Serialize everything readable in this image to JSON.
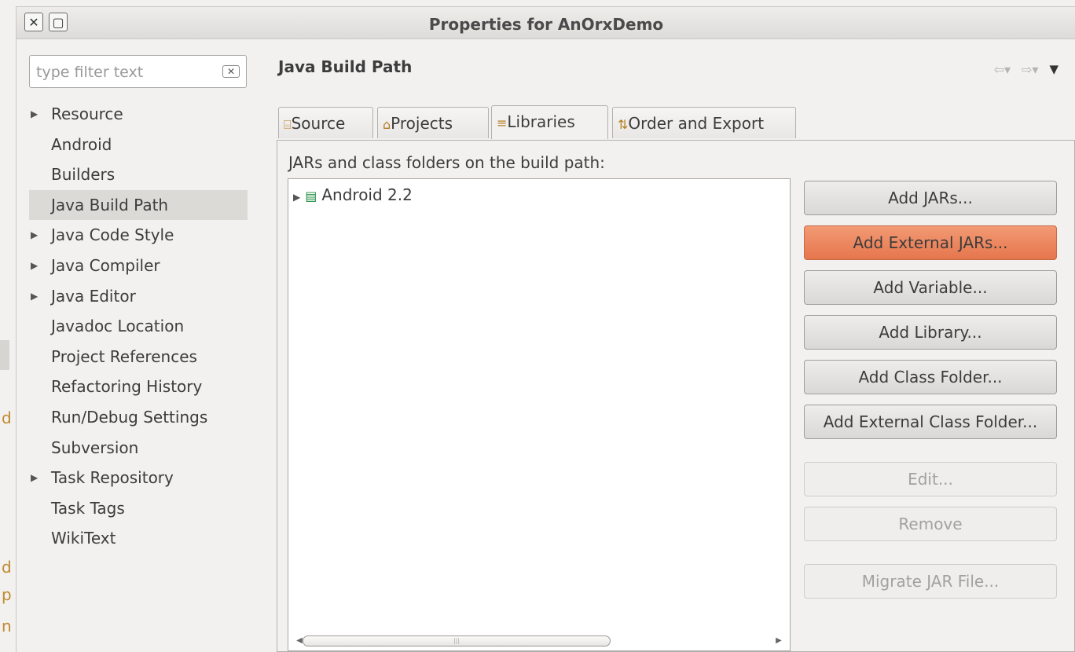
{
  "window": {
    "title": "Properties for AnOrxDemo",
    "close_glyph": "✕",
    "max_glyph": "▢"
  },
  "filter": {
    "placeholder": "type filter text"
  },
  "tree": [
    {
      "label": "Resource",
      "expandable": true
    },
    {
      "label": "Android",
      "expandable": false
    },
    {
      "label": "Builders",
      "expandable": false
    },
    {
      "label": "Java Build Path",
      "expandable": false,
      "selected": true
    },
    {
      "label": "Java Code Style",
      "expandable": true
    },
    {
      "label": "Java Compiler",
      "expandable": true
    },
    {
      "label": "Java Editor",
      "expandable": true
    },
    {
      "label": "Javadoc Location",
      "expandable": false
    },
    {
      "label": "Project References",
      "expandable": false
    },
    {
      "label": "Refactoring History",
      "expandable": false
    },
    {
      "label": "Run/Debug Settings",
      "expandable": false
    },
    {
      "label": "Subversion",
      "expandable": false
    },
    {
      "label": "Task Repository",
      "expandable": true
    },
    {
      "label": "Task Tags",
      "expandable": false
    },
    {
      "label": "WikiText",
      "expandable": false
    }
  ],
  "page": {
    "title": "Java Build Path"
  },
  "tabs": [
    {
      "label": "Source",
      "icon": "source-folder-icon"
    },
    {
      "label": "Projects",
      "icon": "projects-folder-icon"
    },
    {
      "label": "Libraries",
      "icon": "libraries-icon",
      "active": true
    },
    {
      "label": "Order and Export",
      "icon": "order-export-icon"
    }
  ],
  "libraries": {
    "label": "JARs and class folders on the build path:",
    "entries": [
      {
        "label": "Android 2.2",
        "icon": "library-icon"
      }
    ]
  },
  "buttons": [
    {
      "label": "Add JARs...",
      "state": "normal"
    },
    {
      "label": "Add External JARs...",
      "state": "hover"
    },
    {
      "label": "Add Variable...",
      "state": "normal"
    },
    {
      "label": "Add Library...",
      "state": "normal"
    },
    {
      "label": "Add Class Folder...",
      "state": "normal"
    },
    {
      "label": "Add External Class Folder...",
      "state": "normal"
    },
    {
      "label": "Edit...",
      "state": "disabled"
    },
    {
      "label": "Remove",
      "state": "disabled"
    },
    {
      "label": "Migrate JAR File...",
      "state": "disabled"
    }
  ],
  "background_window": {
    "chars": [
      "d",
      "d",
      "p",
      "n"
    ]
  },
  "colors": {
    "hover_button": "#e6764d",
    "selection": "#dcdad6",
    "accent_icon": "#b57d1f"
  }
}
